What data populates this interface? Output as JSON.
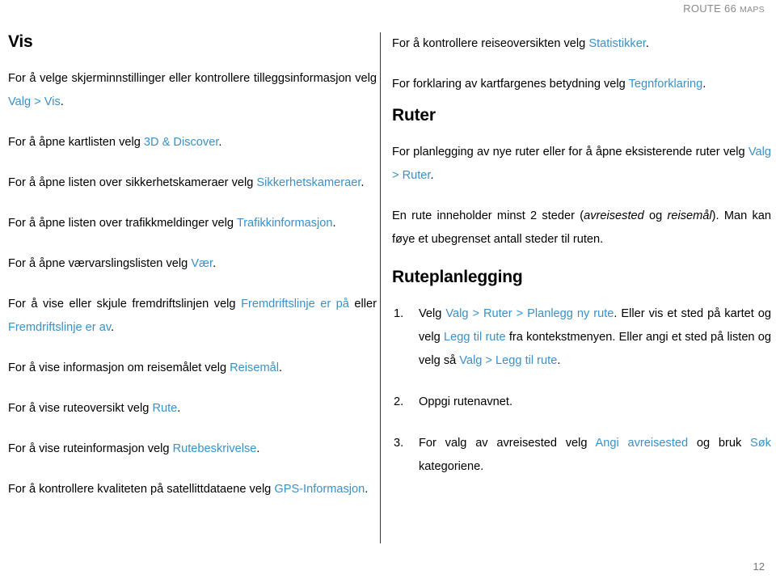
{
  "header": {
    "title_main": "ROUTE 66 ",
    "title_smallcaps": "MAPS"
  },
  "left_column": {
    "heading": "Vis",
    "paragraphs": [
      {
        "id": "vis-valg",
        "parts": [
          {
            "t": "For å velge skjerminnstillinger eller kontrollere tilleggsinformasjon velg ",
            "s": "plain"
          },
          {
            "t": "Valg > Vis",
            "s": "link"
          },
          {
            "t": ".",
            "s": "plain"
          }
        ]
      },
      {
        "id": "kartlisten",
        "parts": [
          {
            "t": "For å åpne kartlisten velg ",
            "s": "plain"
          },
          {
            "t": "3D & Discover",
            "s": "link"
          },
          {
            "t": ".",
            "s": "plain"
          }
        ]
      },
      {
        "id": "sikkerhetskameraer",
        "parts": [
          {
            "t": "For å åpne listen over sikkerhetskameraer velg ",
            "s": "plain"
          },
          {
            "t": "Sikkerhetskameraer",
            "s": "link"
          },
          {
            "t": ".",
            "s": "plain"
          }
        ]
      },
      {
        "id": "trafikkmeldinger",
        "parts": [
          {
            "t": "For å åpne listen over trafikkmeldinger velg ",
            "s": "plain"
          },
          {
            "t": "Trafikkinformasjon",
            "s": "link"
          },
          {
            "t": ".",
            "s": "plain"
          }
        ]
      },
      {
        "id": "vaervarsling",
        "parts": [
          {
            "t": "For å åpne værvarslingslisten velg ",
            "s": "plain"
          },
          {
            "t": "Vær",
            "s": "link"
          },
          {
            "t": ".",
            "s": "plain"
          }
        ]
      },
      {
        "id": "fremdriftslinje",
        "parts": [
          {
            "t": "For å vise eller skjule fremdriftslinjen velg ",
            "s": "plain"
          },
          {
            "t": "Fremdriftslinje er på",
            "s": "link"
          },
          {
            "t": " eller ",
            "s": "plain"
          },
          {
            "t": "Fremdriftslinje er av",
            "s": "link"
          },
          {
            "t": ".",
            "s": "plain"
          }
        ]
      },
      {
        "id": "reisemal",
        "parts": [
          {
            "t": "For å vise informasjon om reisemålet velg ",
            "s": "plain"
          },
          {
            "t": "Reisemål",
            "s": "link"
          },
          {
            "t": ".",
            "s": "plain"
          }
        ]
      },
      {
        "id": "ruteoversikt",
        "parts": [
          {
            "t": "For å vise ruteoversikt velg ",
            "s": "plain"
          },
          {
            "t": "Rute",
            "s": "link"
          },
          {
            "t": ".",
            "s": "plain"
          }
        ]
      },
      {
        "id": "ruteinformasjon",
        "parts": [
          {
            "t": "For å vise ruteinformasjon velg ",
            "s": "plain"
          },
          {
            "t": "Rutebeskrivelse",
            "s": "link"
          },
          {
            "t": ".",
            "s": "plain"
          }
        ]
      },
      {
        "id": "gps-informasjon",
        "parts": [
          {
            "t": "For å kontrollere kvaliteten på satellittdataene velg ",
            "s": "plain"
          },
          {
            "t": "GPS-Informasjon",
            "s": "link"
          },
          {
            "t": ".",
            "s": "plain"
          }
        ]
      }
    ]
  },
  "right_column": {
    "intro_paragraphs": [
      {
        "id": "statistikker",
        "parts": [
          {
            "t": "For å kontrollere reiseoversikten velg ",
            "s": "plain"
          },
          {
            "t": "Statistikker",
            "s": "link"
          },
          {
            "t": ".",
            "s": "plain"
          }
        ]
      },
      {
        "id": "tegnforklaring",
        "parts": [
          {
            "t": "For forklaring av kartfargenes betydning velg ",
            "s": "plain"
          },
          {
            "t": "Tegnforklaring",
            "s": "link"
          },
          {
            "t": ".",
            "s": "plain"
          }
        ]
      }
    ],
    "ruter_heading": "Ruter",
    "ruter_paragraphs": [
      {
        "id": "planlegging",
        "parts": [
          {
            "t": "For planlegging av nye ruter eller for å åpne eksisterende ruter velg ",
            "s": "plain"
          },
          {
            "t": "Valg > Ruter",
            "s": "link"
          },
          {
            "t": ".",
            "s": "plain"
          }
        ]
      },
      {
        "id": "rute-steder",
        "parts": [
          {
            "t": "En rute inneholder minst 2 steder (",
            "s": "plain"
          },
          {
            "t": "avreisested",
            "s": "italic"
          },
          {
            "t": " og ",
            "s": "plain"
          },
          {
            "t": "reisemål",
            "s": "italic"
          },
          {
            "t": "). Man kan føye et ubegrenset antall steder til ruten.",
            "s": "plain"
          }
        ]
      }
    ],
    "ruteplanlegging_heading": "Ruteplanlegging",
    "steps": [
      {
        "number": "1.",
        "parts": [
          {
            "t": "Velg ",
            "s": "plain"
          },
          {
            "t": "Valg > Ruter > Planlegg ny rute",
            "s": "link"
          },
          {
            "t": ". Eller vis et sted på kartet og velg ",
            "s": "plain"
          },
          {
            "t": "Legg til rute",
            "s": "link"
          },
          {
            "t": " fra kontekstmenyen. Eller angi et sted på listen og velg så ",
            "s": "plain"
          },
          {
            "t": "Valg > Legg til rute",
            "s": "link"
          },
          {
            "t": ".",
            "s": "plain"
          }
        ]
      },
      {
        "number": "2.",
        "parts": [
          {
            "t": "Oppgi rutenavnet.",
            "s": "plain"
          }
        ]
      },
      {
        "number": "3.",
        "parts": [
          {
            "t": "For valg av avreisested velg ",
            "s": "plain"
          },
          {
            "t": "Angi avreisested",
            "s": "link"
          },
          {
            "t": " og bruk ",
            "s": "plain"
          },
          {
            "t": "Søk",
            "s": "link"
          },
          {
            "t": " kategoriene.",
            "s": "plain"
          }
        ]
      }
    ]
  },
  "footer": {
    "page_number": "12"
  },
  "colors": {
    "link": "#3a91c8",
    "header_text": "#8a8a8a",
    "divider": "#3a3a3a",
    "body_text": "#000000"
  }
}
